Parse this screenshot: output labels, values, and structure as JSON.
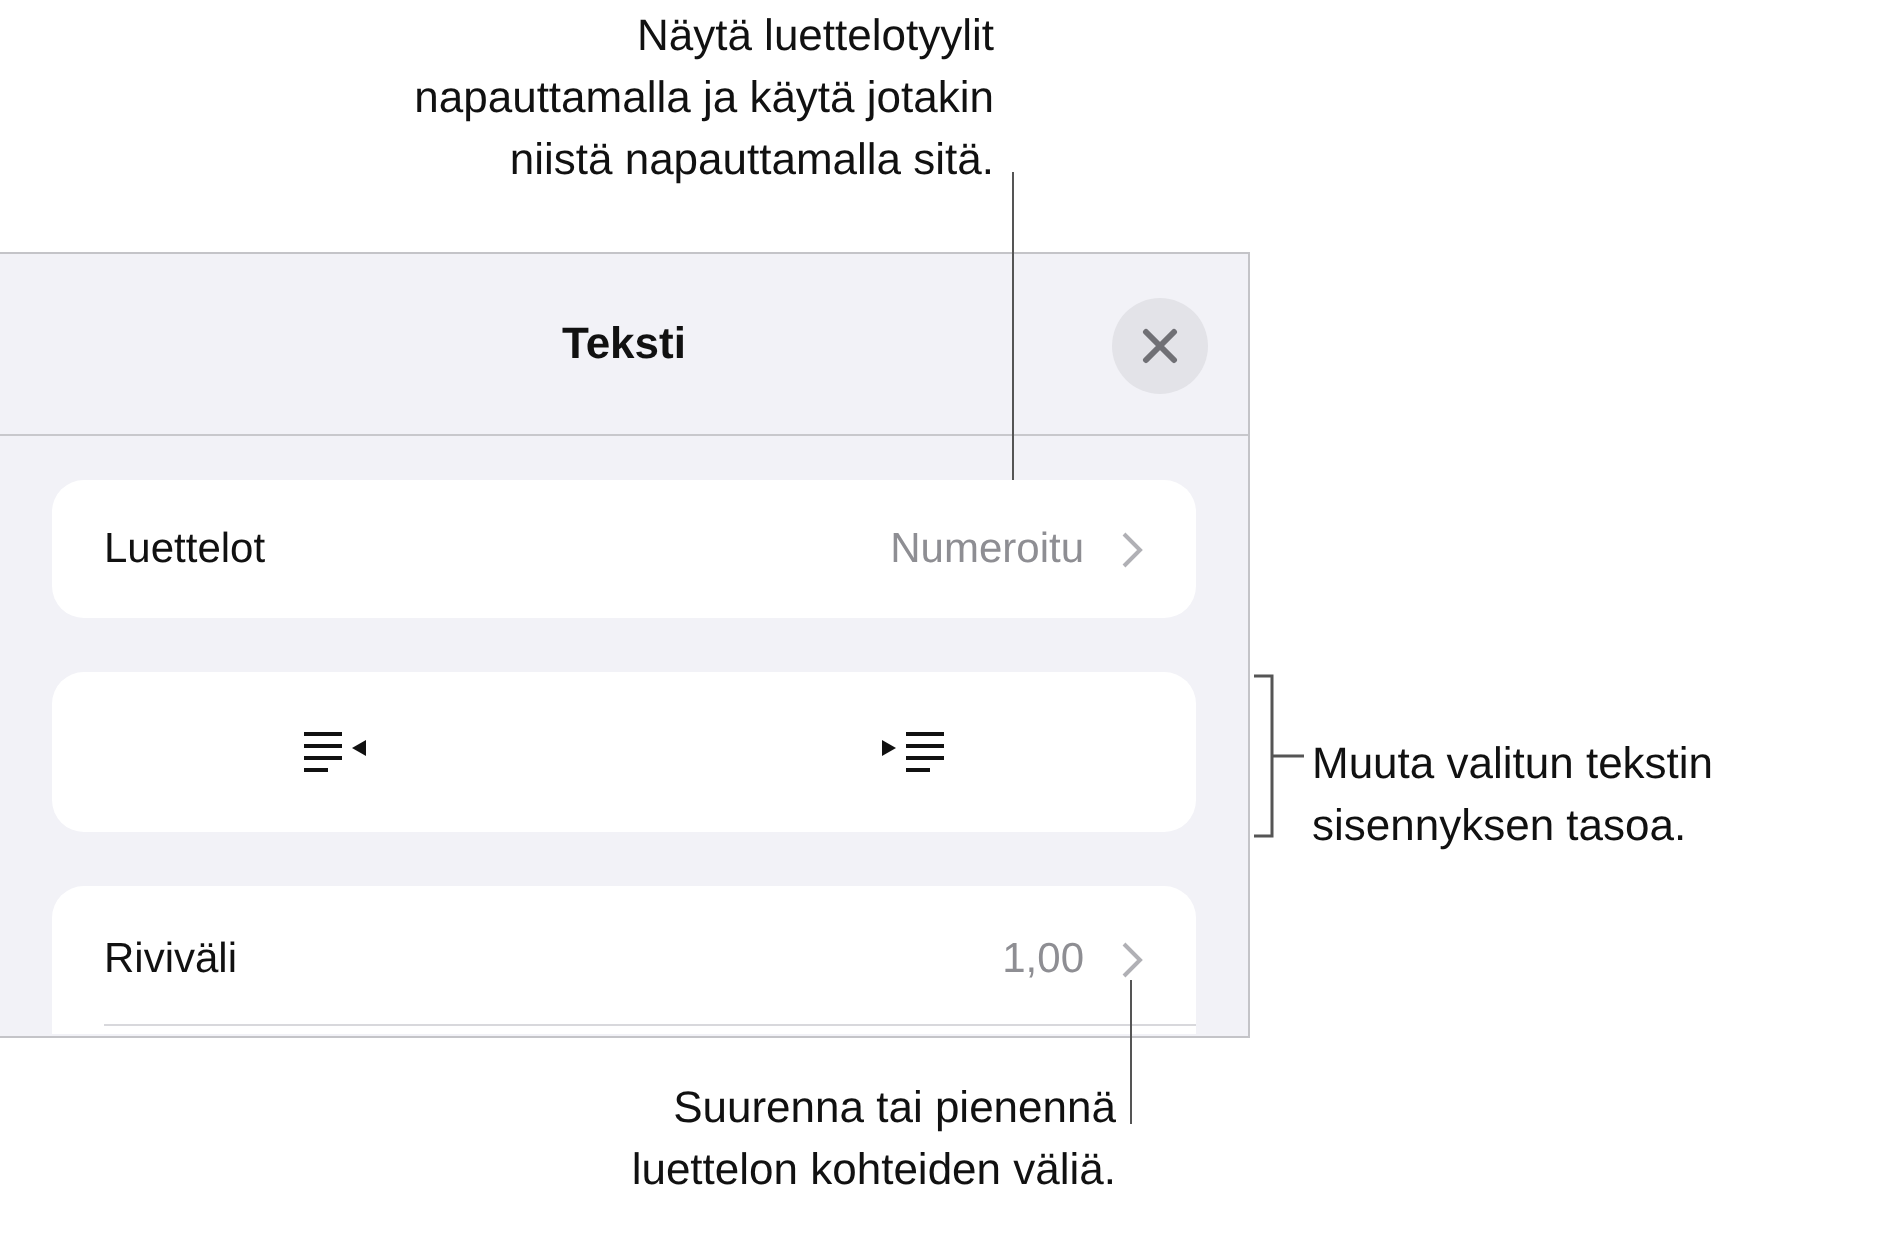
{
  "panel": {
    "title": "Teksti",
    "rows": [
      {
        "kind": "disclosure",
        "label": "Luettelot",
        "value": "Numeroitu"
      },
      {
        "kind": "indent"
      },
      {
        "kind": "disclosure",
        "label": "Riviväli",
        "value": "1,00"
      }
    ]
  },
  "callouts": [
    {
      "kind": "top",
      "lines": [
        "Näytä luettelotyylit",
        "napauttamalla ja käytä jotakin",
        "niistä napauttamalla sitä."
      ]
    },
    {
      "kind": "bracket",
      "lines": [
        "Muuta valitun tekstin",
        "sisennyksen tasoa."
      ]
    },
    {
      "kind": "bottom",
      "lines": [
        "Suurenna tai pienennä",
        "luettelon kohteiden väliä."
      ]
    }
  ]
}
